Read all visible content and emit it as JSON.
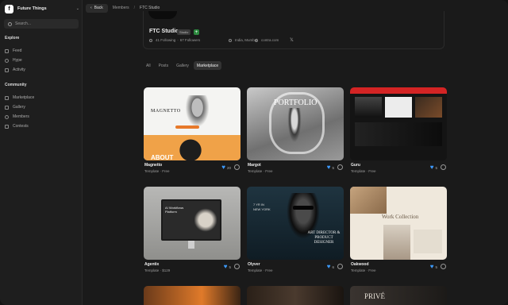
{
  "workspace": {
    "name": "Future Things",
    "logo": "f"
  },
  "search": {
    "placeholder": "Search..."
  },
  "sidebar": {
    "explore_title": "Explore",
    "explore": [
      {
        "label": "Feed",
        "icon": "feed-icon"
      },
      {
        "label": "Hype",
        "icon": "flame-icon"
      },
      {
        "label": "Activity",
        "icon": "activity-icon"
      }
    ],
    "community_title": "Community",
    "community": [
      {
        "label": "Marketplace",
        "icon": "store-icon"
      },
      {
        "label": "Gallery",
        "icon": "image-icon"
      },
      {
        "label": "Members",
        "icon": "users-icon"
      },
      {
        "label": "Contests",
        "icon": "trophy-icon"
      }
    ]
  },
  "topbar": {
    "back": "Back",
    "crumbs": [
      "Members",
      "FTC Studio"
    ]
  },
  "profile": {
    "name": "FTC Studio",
    "badge": "Studio",
    "plus": "+",
    "following": "41 Following",
    "followers": "67 Followers",
    "location": "India, Mumbai",
    "website": "contra.com",
    "x": "𝕏"
  },
  "tabs": [
    "All",
    "Posts",
    "Gallery",
    "Marketplace"
  ],
  "active_tab": "Marketplace",
  "thumb_text": {
    "magnetto": "MAGNETTO",
    "about": "ABOUT",
    "portfolio": "PORTFOLIO",
    "agentix": "AI Workflows Platform",
    "olyver_big": "ART DIRECTOR & PRODUCT DESIGNER",
    "olyver_small": "7 YR IN NEW YORK",
    "oakwood": "Work Collection",
    "prive": "PRIVÉ"
  },
  "cards": [
    {
      "title": "Magnetto",
      "subtitle": "Template · Free",
      "likes": "20"
    },
    {
      "title": "Margot",
      "subtitle": "Template · Free",
      "likes": "5"
    },
    {
      "title": "Guru",
      "subtitle": "Template · Free",
      "likes": "5"
    },
    {
      "title": "Agentix",
      "subtitle": "Template · $129",
      "likes": "5"
    },
    {
      "title": "Olyver",
      "subtitle": "Template · Free",
      "likes": "6"
    },
    {
      "title": "Oakwood",
      "subtitle": "Template · Free",
      "likes": "5"
    }
  ],
  "colors": {
    "accent_like": "#3d9bff",
    "badge_green": "#2d8a3f",
    "background": "#1a1a1a"
  }
}
